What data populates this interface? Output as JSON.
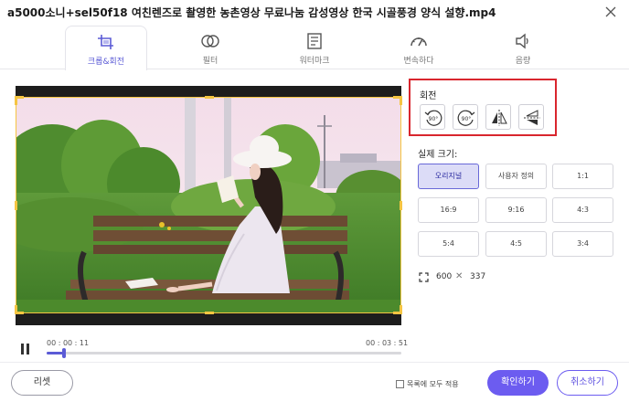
{
  "window": {
    "title": "a5000소니+sel50f18 여친렌즈로 촬영한 농촌영상 무료나눔 감성영상 한국 시골풍경 양식 설향.mp4",
    "close_icon": "close-icon"
  },
  "tabs": [
    {
      "label": "크롭&회전",
      "icon": "crop-icon",
      "active": true
    },
    {
      "label": "필터",
      "icon": "filter-icon",
      "active": false
    },
    {
      "label": "워터마크",
      "icon": "watermark-icon",
      "active": false
    },
    {
      "label": "변속하다",
      "icon": "speed-icon",
      "active": false
    },
    {
      "label": "음량",
      "icon": "volume-icon",
      "active": false
    }
  ],
  "player": {
    "current_time": "00 : 00 : 11",
    "total_time": "00 : 03 : 51",
    "progress": 0.048
  },
  "rotate": {
    "title": "회전",
    "rotate_left_label": "90°",
    "rotate_right_label": "90°"
  },
  "aspect": {
    "title": "실제 크기:",
    "options": [
      "오리지널",
      "사용자 정의",
      "1:1",
      "16:9",
      "9:16",
      "4:3",
      "5:4",
      "4:5",
      "3:4"
    ],
    "selected": "오리지널"
  },
  "size": {
    "width": "600",
    "separator": "✕",
    "height": "337"
  },
  "footer": {
    "reset_label": "리셋",
    "apply_all_label": "목록에 모두 적용",
    "confirm_label": "확인하기",
    "cancel_label": "취소하기"
  },
  "colors": {
    "accent": "#6c5cf0",
    "highlight_border": "#d9262e",
    "crop_handle": "#f5c542"
  }
}
